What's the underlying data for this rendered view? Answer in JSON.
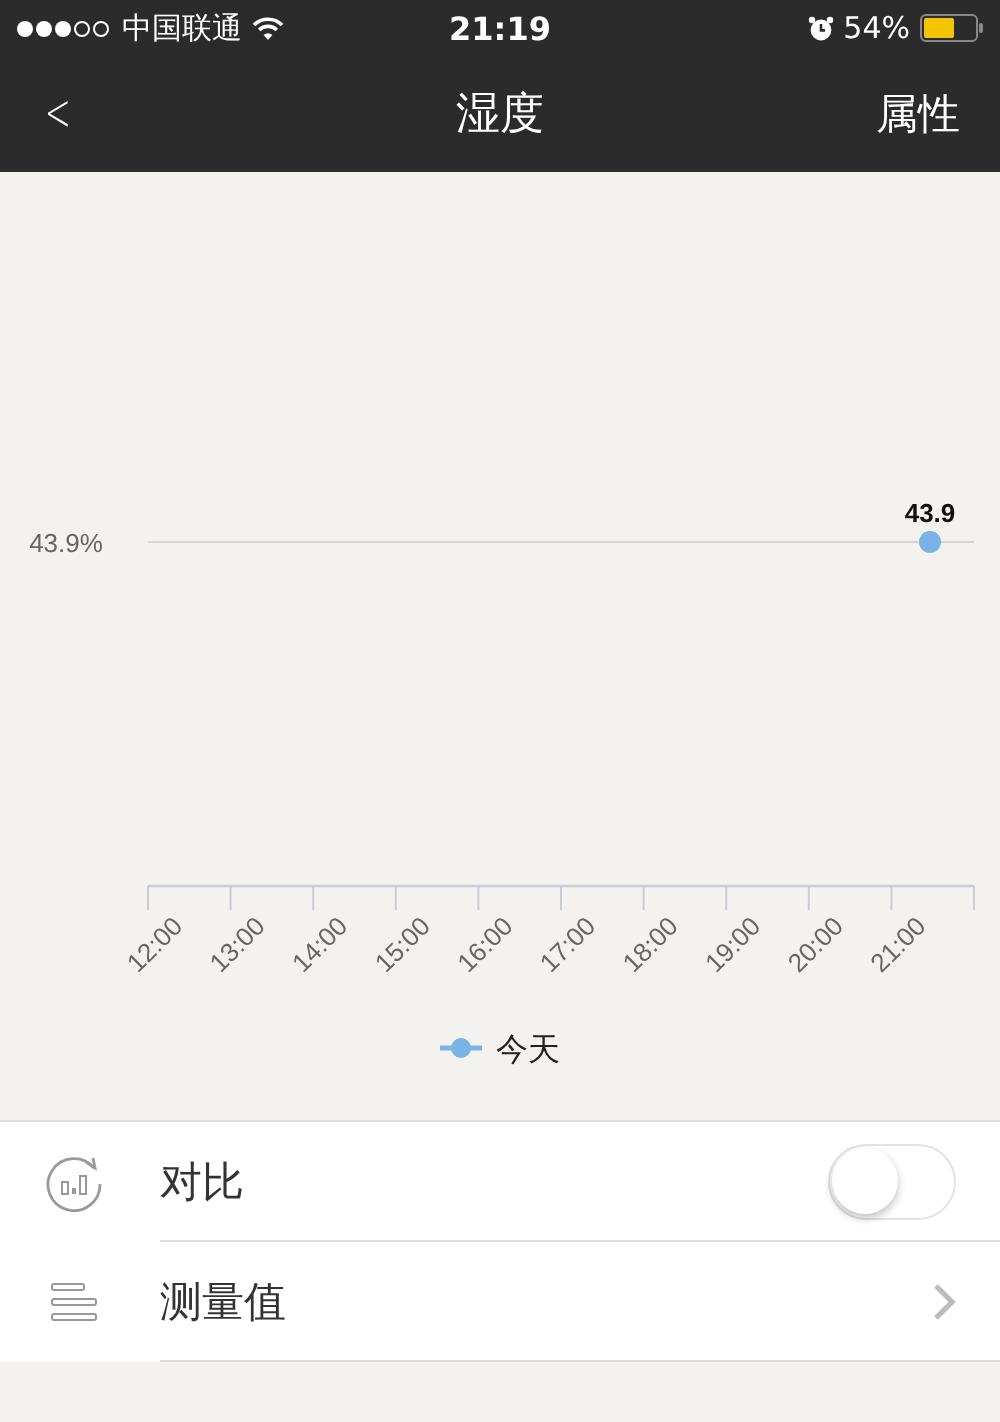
{
  "status_bar": {
    "carrier": "中国联通",
    "time": "21:19",
    "battery": "54%"
  },
  "nav": {
    "back": "<",
    "title": "湿度",
    "action": "属性"
  },
  "chart": {
    "reference_label": "43.9%",
    "point_label": "43.9",
    "time_labels": [
      "12:00",
      "13:00",
      "14:00",
      "15:00",
      "16:00",
      "17:00",
      "18:00",
      "19:00",
      "20:00",
      "21:00"
    ],
    "legend_label": "今天"
  },
  "options": [
    {
      "kind": "toggle",
      "label": "对比",
      "on": false
    },
    {
      "kind": "link",
      "label": "测量值"
    }
  ]
}
